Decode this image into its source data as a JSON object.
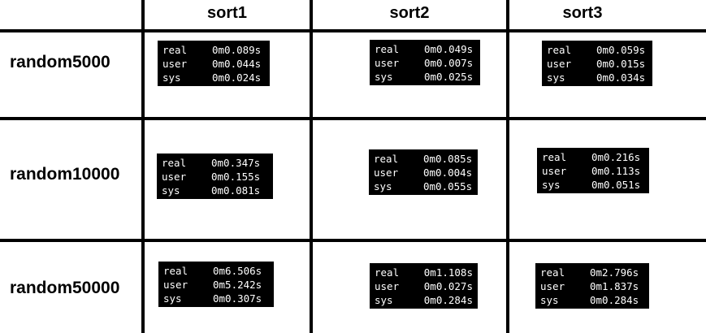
{
  "columns": [
    "sort1",
    "sort2",
    "sort3"
  ],
  "rows": [
    {
      "label": "random5000",
      "cells": [
        {
          "real": "0m0.089s",
          "user": "0m0.044s",
          "sys": "0m0.024s"
        },
        {
          "real": "0m0.049s",
          "user": "0m0.007s",
          "sys": "0m0.025s"
        },
        {
          "real": "0m0.059s",
          "user": "0m0.015s",
          "sys": "0m0.034s"
        }
      ]
    },
    {
      "label": "random10000",
      "cells": [
        {
          "real": "0m0.347s",
          "user": "0m0.155s",
          "sys": "0m0.081s"
        },
        {
          "real": "0m0.085s",
          "user": "0m0.004s",
          "sys": "0m0.055s"
        },
        {
          "real": "0m0.216s",
          "user": "0m0.113s",
          "sys": "0m0.051s"
        }
      ]
    },
    {
      "label": "random50000",
      "cells": [
        {
          "real": "0m6.506s",
          "user": "0m5.242s",
          "sys": "0m0.307s"
        },
        {
          "real": "0m1.108s",
          "user": "0m0.027s",
          "sys": "0m0.284s"
        },
        {
          "real": "0m2.796s",
          "user": "0m1.837s",
          "sys": "0m0.284s"
        }
      ]
    }
  ],
  "time_labels": {
    "real": "real",
    "user": "user",
    "sys": "sys"
  }
}
